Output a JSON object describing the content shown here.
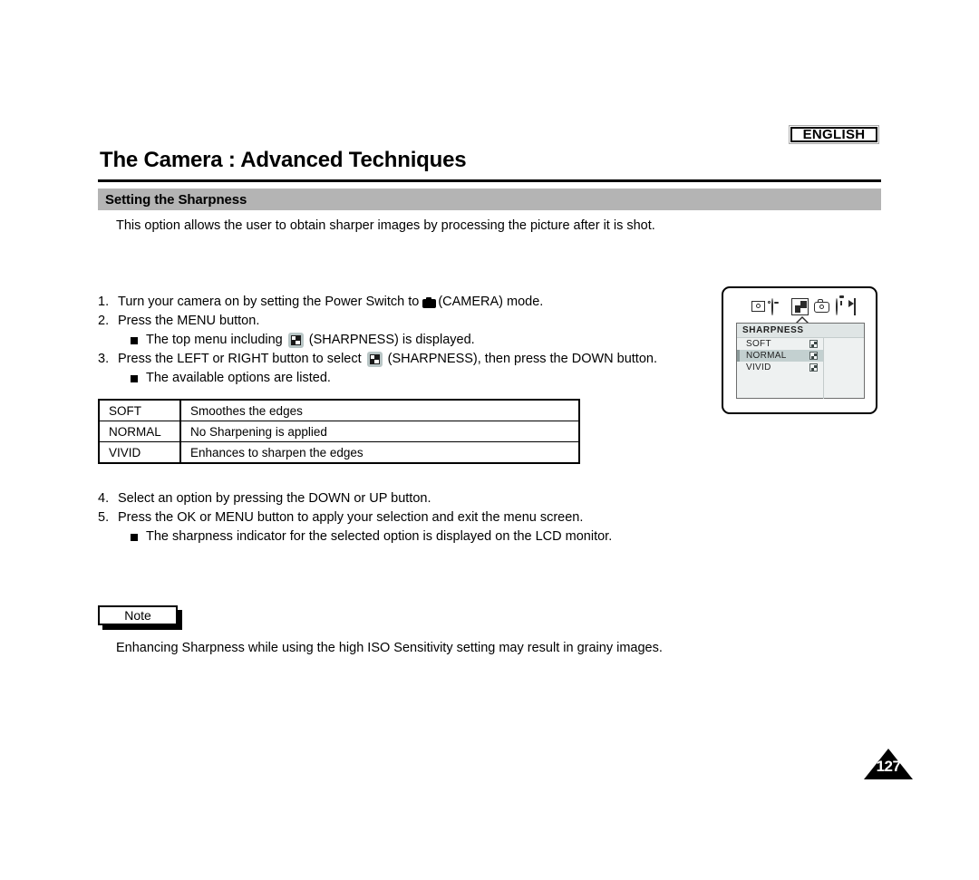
{
  "header": {
    "language_badge": "ENGLISH",
    "title": "The Camera : Advanced Techniques",
    "section_title": "Setting the Sharpness"
  },
  "intro": "This option allows the user to obtain sharper images by processing the picture after it is shot.",
  "steps": [
    {
      "num": "1.",
      "text_before": "Turn your camera on by setting the Power Switch to",
      "icon": "camera-icon",
      "text_after": "(CAMERA) mode."
    },
    {
      "num": "2.",
      "text_before": "Press the MENU button.",
      "icon": "",
      "text_after": ""
    },
    {
      "num": "3.",
      "text_before": "Press the LEFT or RIGHT button to select",
      "icon": "sharpness-icon",
      "text_after": "(SHARPNESS), then press the DOWN button."
    },
    {
      "num": "4.",
      "text_before": "Select an option by pressing the DOWN or UP button.",
      "icon": "",
      "text_after": ""
    },
    {
      "num": "5.",
      "text_before": "Press the OK or MENU button to apply your selection and exit the menu screen.",
      "icon": "",
      "text_after": ""
    }
  ],
  "bullets": {
    "after_step2_before": "The top menu including",
    "after_step2_icon": "sharpness-icon",
    "after_step2_after": "(SHARPNESS) is displayed.",
    "after_step3": "The available options are listed.",
    "after_step5": "The sharpness indicator for the selected option is displayed on the LCD monitor."
  },
  "options_table": {
    "rows": [
      {
        "key": "SOFT",
        "desc": "Smoothes the edges"
      },
      {
        "key": "NORMAL",
        "desc": "No Sharpening is applied"
      },
      {
        "key": "VIVID",
        "desc": "Enhances to sharpen the edges"
      }
    ]
  },
  "lcd": {
    "icons": [
      "mosaic-grid-icon",
      "photo-quality-icon",
      "white-balance-palette-icon",
      "sharpness-icon-selected",
      "camera-icon",
      "self-timer-icon",
      "exit-icon"
    ],
    "submenu": {
      "title": "SHARPNESS",
      "options": [
        {
          "label": "SOFT",
          "selected": false
        },
        {
          "label": "NORMAL",
          "selected": true
        },
        {
          "label": "VIVID",
          "selected": false
        }
      ]
    }
  },
  "note": {
    "label": "Note",
    "text": "Enhancing Sharpness while using the high ISO Sensitivity setting may result in grainy images."
  },
  "page_number": "127",
  "colors": {
    "section_bar": "#b4b4b4",
    "submenu_bg": "#eef1f1",
    "submenu_title_bg": "#dfe5e5",
    "selection_highlight": "#c3d0d0",
    "inline_icon_bg": "#b9c6c6"
  }
}
